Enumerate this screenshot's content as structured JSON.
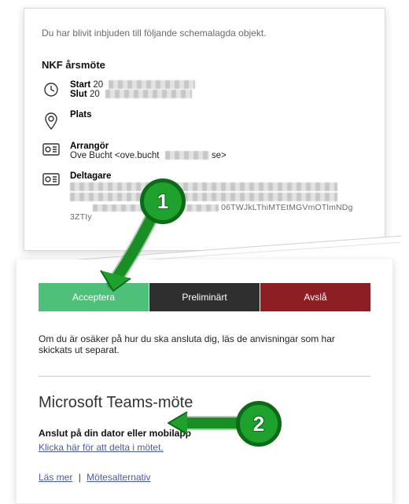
{
  "intro": "Du har blivit inbjuden till följande schemalagda objekt.",
  "meeting": {
    "title": "NKF årsmöte",
    "start_label": "Start",
    "start_value": "20",
    "end_label": "Slut",
    "end_value": "20",
    "location_label": "Plats",
    "organizer_label": "Arrangör",
    "organizer_value": "Ove Bucht <ove.bucht",
    "organizer_tail": "se>",
    "participants_label": "Deltagare",
    "garble_line": "06TWJkLThiMTEtMGVmOTlmNDg3ZTIy"
  },
  "buttons": {
    "accept": "Acceptera",
    "tentative": "Preliminärt",
    "decline": "Avslå"
  },
  "unsure_text": "Om du är osäker på hur du ska ansluta dig, läs de anvisningar som har skickats ut separat.",
  "teams": {
    "heading": "Microsoft Teams-möte",
    "join_label": "Anslut på din dator eller mobilapp",
    "join_link": "Klicka här för att delta i mötet.",
    "learn_more": "Läs mer",
    "options": "Mötesalternativ"
  },
  "annotations": {
    "step1": "1",
    "step2": "2"
  },
  "colors": {
    "accept": "#4fc07a",
    "tentative": "#2f2f2f",
    "decline": "#8d1f24",
    "annotation": "#1fa22d"
  }
}
